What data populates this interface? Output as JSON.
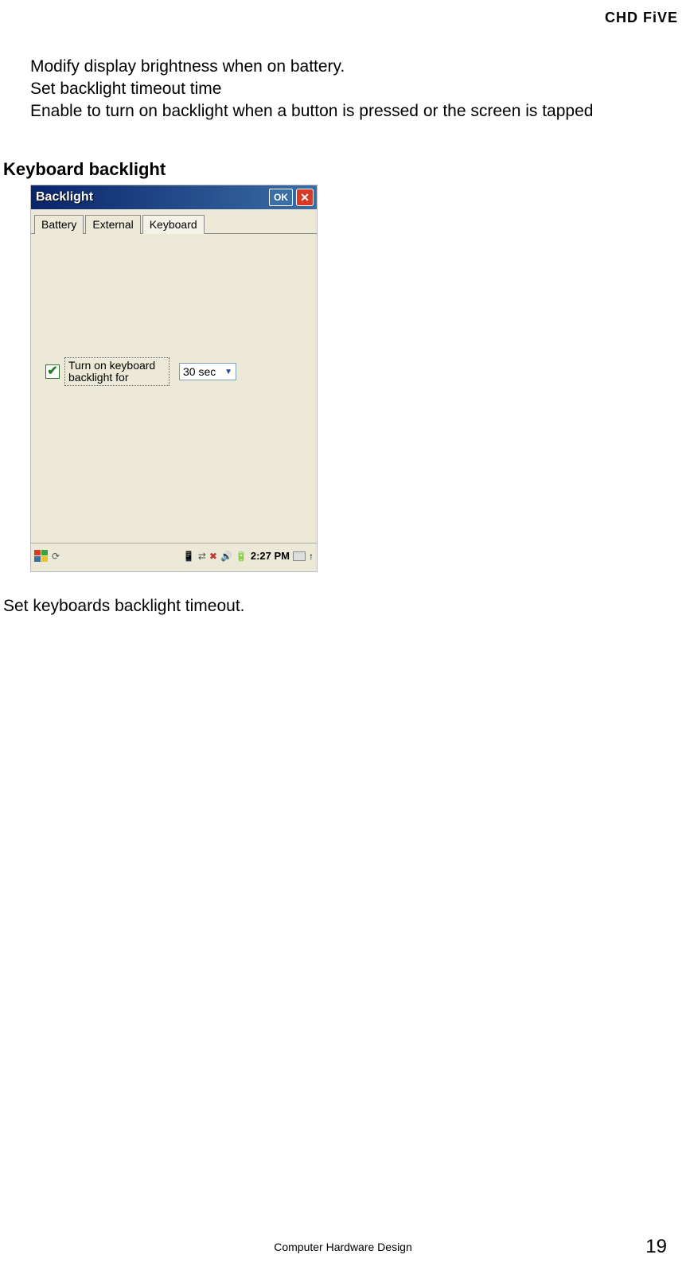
{
  "header": {
    "brand": "CHD FiVE"
  },
  "intro": {
    "line1": "Modify display brightness when on battery.",
    "line2": "Set backlight timeout time",
    "line3": "Enable to turn on backlight when a button is pressed or the screen is tapped"
  },
  "section": {
    "heading": "Keyboard backlight"
  },
  "dialog": {
    "title": "Backlight",
    "ok": "OK",
    "close": "✕",
    "tabs": {
      "battery": "Battery",
      "external": "External",
      "keyboard": "Keyboard"
    },
    "content": {
      "checkbox_label": "Turn on keyboard backlight  for",
      "dropdown_value": "30 sec"
    },
    "taskbar": {
      "clock": "2:27 PM"
    }
  },
  "caption": "Set keyboards backlight timeout.",
  "footer": {
    "center": "Computer Hardware Design",
    "page": "19"
  }
}
